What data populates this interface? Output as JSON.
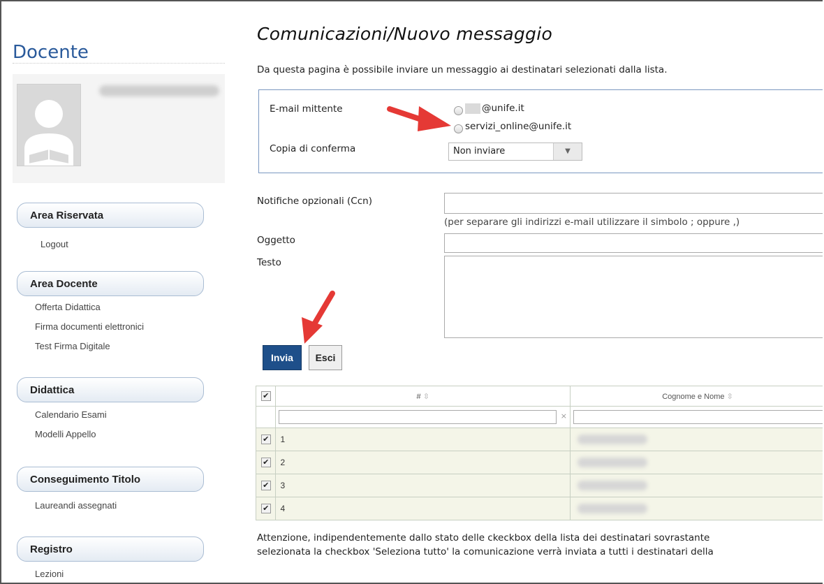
{
  "sidebar": {
    "title": "Docente",
    "sections": [
      {
        "heading": "Area Riservata",
        "links": [
          "Logout"
        ]
      },
      {
        "heading": "Area Docente",
        "links": [
          "Offerta Didattica",
          "Firma documenti elettronici",
          "Test Firma Digitale"
        ]
      },
      {
        "heading": "Didattica",
        "links": [
          "Calendario Esami",
          "Modelli Appello"
        ]
      },
      {
        "heading": "Conseguimento Titolo",
        "links": [
          "Laureandi assegnati"
        ]
      },
      {
        "heading": "Registro",
        "links": [
          "Lezioni"
        ]
      }
    ]
  },
  "main": {
    "title": "Comunicazioni/Nuovo messaggio",
    "intro": "Da questa pagina è possibile inviare un messaggio ai destinatari selezionati dalla lista.",
    "sender": {
      "label": "E-mail mittente",
      "option1": "@unife.it",
      "option2": "servizi_online@unife.it"
    },
    "copy": {
      "label": "Copia di conferma",
      "value": "Non inviare"
    },
    "ccn": {
      "label": "Notifiche opzionali (Ccn)",
      "hint": "(per separare gli indirizzi e-mail utilizzare il simbolo ; oppure ,)"
    },
    "subject_label": "Oggetto",
    "text_label": "Testo",
    "buttons": {
      "send": "Invia",
      "exit": "Esci"
    },
    "table": {
      "headers": [
        "#",
        "Cognome e Nome"
      ],
      "sort_glyph": "⇳",
      "clear_glyph": "×",
      "rows": [
        "1",
        "2",
        "3",
        "4"
      ]
    },
    "warning_line1": "Attenzione, indipendentemente dallo stato delle ckeckbox della lista dei destinatari sovrastante",
    "warning_line2": "selezionata la checkbox 'Seleziona tutto' la comunicazione verrà inviata a tutti i destinatari della"
  },
  "colors": {
    "accent": "#1e4f8a",
    "title_blue": "#2a5a9b",
    "arrow_red": "#e53935"
  }
}
